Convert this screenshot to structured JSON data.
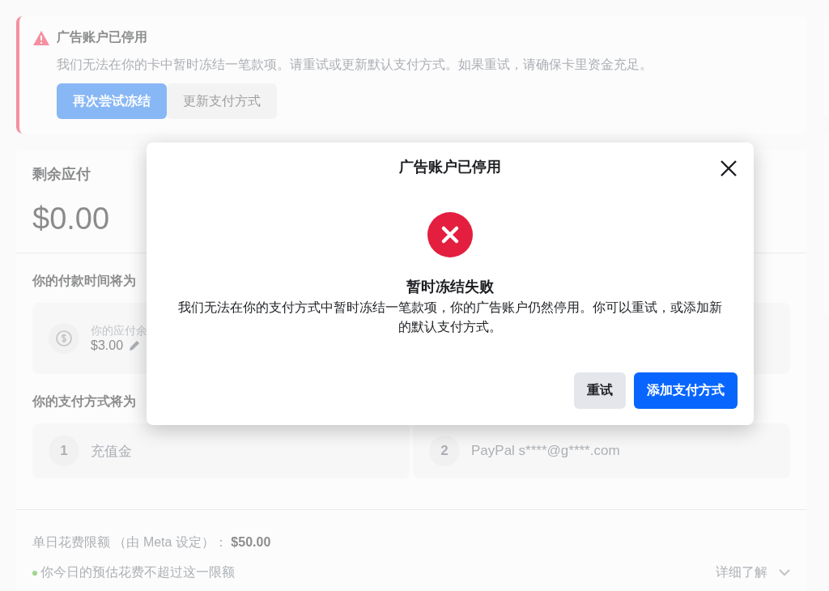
{
  "alert": {
    "title": "广告账户已停用",
    "message": "我们无法在你的卡中暂时冻结一笔款项。请重试或更新默认支付方式。如果重试，请确保卡里资金充足。",
    "buttons": [
      {
        "label": "再次尝试冻结",
        "kind": "primary"
      },
      {
        "label": "更新支付方式",
        "kind": "secondary"
      }
    ]
  },
  "balance": {
    "title": "剩余应付",
    "amount": "$0.00"
  },
  "payment_time": {
    "heading": "你的付款时间将为",
    "threshold_label": "你的应付余",
    "threshold_amount": "$3.00"
  },
  "payment_methods": {
    "heading": "你的支付方式将为",
    "items": [
      {
        "index": "1",
        "name": "充值金"
      },
      {
        "index": "2",
        "name": "PayPal s****@g****.com"
      }
    ]
  },
  "spending_limit": {
    "text": "单日花费限额 （由 Meta 设定）： **$50.00**",
    "status": "你今日的预估花费不超过这一限额",
    "learn_more": "详细了解"
  },
  "dialog": {
    "title": "广告账户已停用",
    "heading": "暂时冻结失败",
    "message": "我们无法在你的支付方式中暂时冻结一笔款项，你的广告账户仍然停用。你可以重试，或添加新的默认支付方式。",
    "buttons": [
      {
        "label": "重试",
        "kind": "secondary"
      },
      {
        "label": "添加支付方式",
        "kind": "primary"
      }
    ]
  }
}
